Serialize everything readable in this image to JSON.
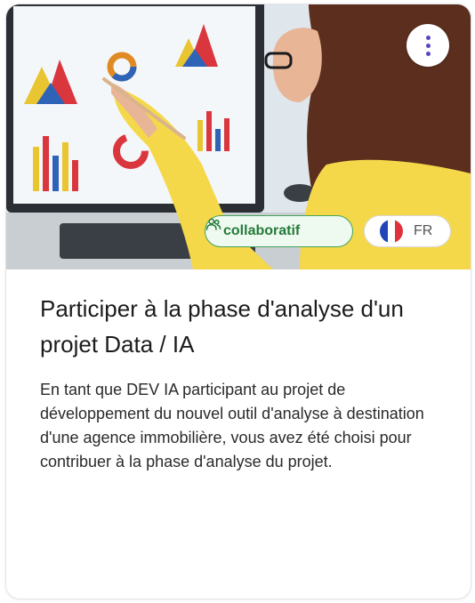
{
  "card": {
    "title": "Participer à la phase d'analyse d'un projet Data / IA",
    "description": "En tant que DEV IA participant au projet de développement du nouvel outil d'analyse à destination d'une agence immobilière, vous avez été choisi pour contribuer à la phase d'analyse du projet.",
    "menu_icon": "more-vertical-icon",
    "tags": {
      "collaborative": {
        "label": "collaboratif",
        "icon": "users-icon",
        "color": "#237a38"
      },
      "language": {
        "label": "FR",
        "icon": "flag-fr-icon"
      }
    },
    "image_alt_icon": "woman-pointing-at-charts-image"
  }
}
